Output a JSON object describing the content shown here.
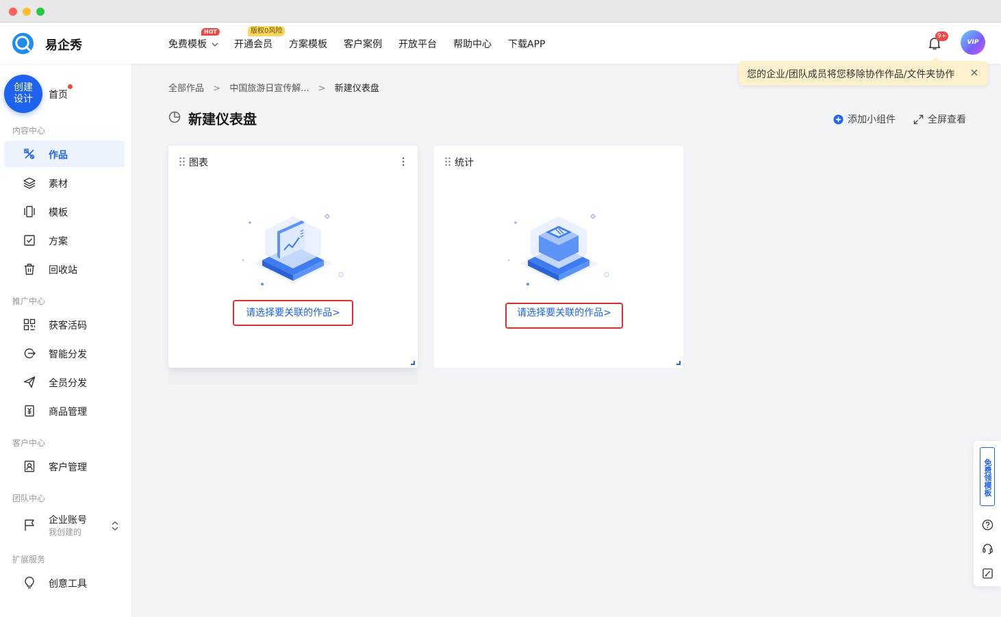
{
  "app": {
    "name": "易企秀"
  },
  "topnav": {
    "items": [
      {
        "label": "免费模板"
      },
      {
        "label": "开通会员"
      },
      {
        "label": "方案模板"
      },
      {
        "label": "客户案例"
      },
      {
        "label": "开放平台"
      },
      {
        "label": "帮助中心"
      },
      {
        "label": "下载APP"
      }
    ],
    "hot_badge": "HOT",
    "vip_badge": "版权0风险",
    "notification_count": "9+",
    "avatar_label": "VIP"
  },
  "tooltip": {
    "text": "您的企业/团队成员将您移除协作作品/文件夹协作"
  },
  "sidebar": {
    "create_button": [
      "创建",
      "设计"
    ],
    "home": "首页",
    "sections": {
      "content": "内容中心",
      "promotion": "推广中心",
      "customer": "客户中心",
      "team": "团队中心",
      "extension": "扩展服务"
    },
    "items": {
      "works": "作品",
      "materials": "素材",
      "templates": "模板",
      "plans": "方案",
      "recycle": "回收站",
      "qr_code": "获客活码",
      "smart_share": "智能分发",
      "all_share": "全员分发",
      "products": "商品管理",
      "customers": "客户管理",
      "enterprise": "企业账号",
      "enterprise_sub": "我创建的",
      "creative_tools": "创意工具"
    }
  },
  "breadcrumb": {
    "all_works": "全部作品",
    "parent": "中国旅游日宣传解...",
    "current": "新建仪表盘",
    "separator": ">"
  },
  "page": {
    "title": "新建仪表盘",
    "add_widget": "添加小组件",
    "fullscreen": "全屏查看"
  },
  "cards": [
    {
      "title": "图表",
      "link": "请选择要关联的作品>"
    },
    {
      "title": "统计",
      "link": "请选择要关联的作品>"
    }
  ],
  "float_panel": {
    "free_templates": "免费领模板"
  },
  "colors": {
    "primary": "#1e63f0",
    "alert": "#f04844",
    "highlight_border": "#e02d2d",
    "tooltip_bg": "#fdf0cc"
  }
}
